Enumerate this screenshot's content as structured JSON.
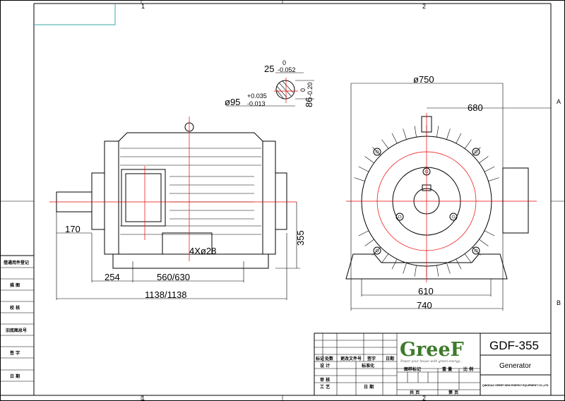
{
  "zones": {
    "col1": "1",
    "col2": "2",
    "rowA": "A",
    "rowB": "B"
  },
  "section": {
    "key_width": "25",
    "key_tol_upper": "0",
    "key_tol_lower": "-0.052",
    "shaft_dia": "ø95",
    "shaft_tol_upper": "+0.035",
    "shaft_tol_lower": "-0.013",
    "depth": "86",
    "depth_tol_upper": "0",
    "depth_tol_lower": "-0.20"
  },
  "side_view": {
    "shaft_len": "170",
    "foot_offset": "254",
    "foot_span": "560/630",
    "holes": "4Xø28",
    "height": "355",
    "total_len": "1138/1138"
  },
  "front_view": {
    "dia": "ø750",
    "box_width": "680",
    "foot_width": "610",
    "base_width": "740"
  },
  "left_strip": [
    "借通用件登记",
    "描 图",
    "校 核",
    "旧底图总号",
    "签 字",
    "日 期"
  ],
  "title_block": {
    "rev_headers": [
      "标记",
      "处数",
      "更改文件号",
      "签字",
      "日期"
    ],
    "design": "设 计",
    "standard": "标准化",
    "review": "审 核",
    "process": "工 艺",
    "date": "日 期",
    "mark": "图样标记",
    "weight": "重 量",
    "scale": "比 例",
    "total": "共 页",
    "sheet": "第 页",
    "logo": "GreeF",
    "slogan": "Power your house with green energy...",
    "model": "GDF-355",
    "name": "Generator",
    "company": "QINGDAO GREEF NEW ENERGY EQUIPMENT CO.,LTD"
  },
  "colors": {
    "line": "#000000",
    "center": "#e00000",
    "frame": "#3aa6a6",
    "logo_green": "#3d7a2a"
  }
}
